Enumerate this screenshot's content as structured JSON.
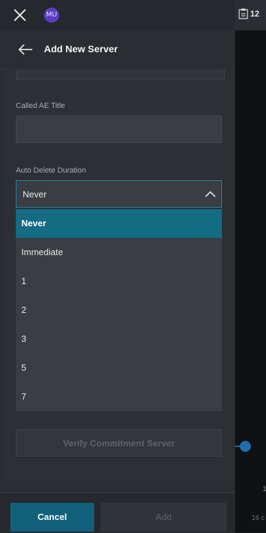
{
  "topbar": {
    "avatar_initials": "MU"
  },
  "header": {
    "title": "Add New Server"
  },
  "form": {
    "called_ae_title_label": "Called AE Title",
    "called_ae_title_value": "",
    "auto_delete_label": "Auto Delete Duration",
    "auto_delete_value": "Never",
    "auto_delete_options": [
      "Never",
      "Immediate",
      "1",
      "2",
      "3",
      "5",
      "7"
    ],
    "verify_button": "Verify Commitment Server"
  },
  "footer": {
    "cancel": "Cancel",
    "add": "Add"
  },
  "right_panel": {
    "count": "12",
    "edge_number": "1",
    "edge_text": "16 c"
  },
  "colors": {
    "accent": "#136b84",
    "primary_button": "#10607a",
    "avatar": "#5b3cc4",
    "timeline": "#1f6fb0"
  }
}
